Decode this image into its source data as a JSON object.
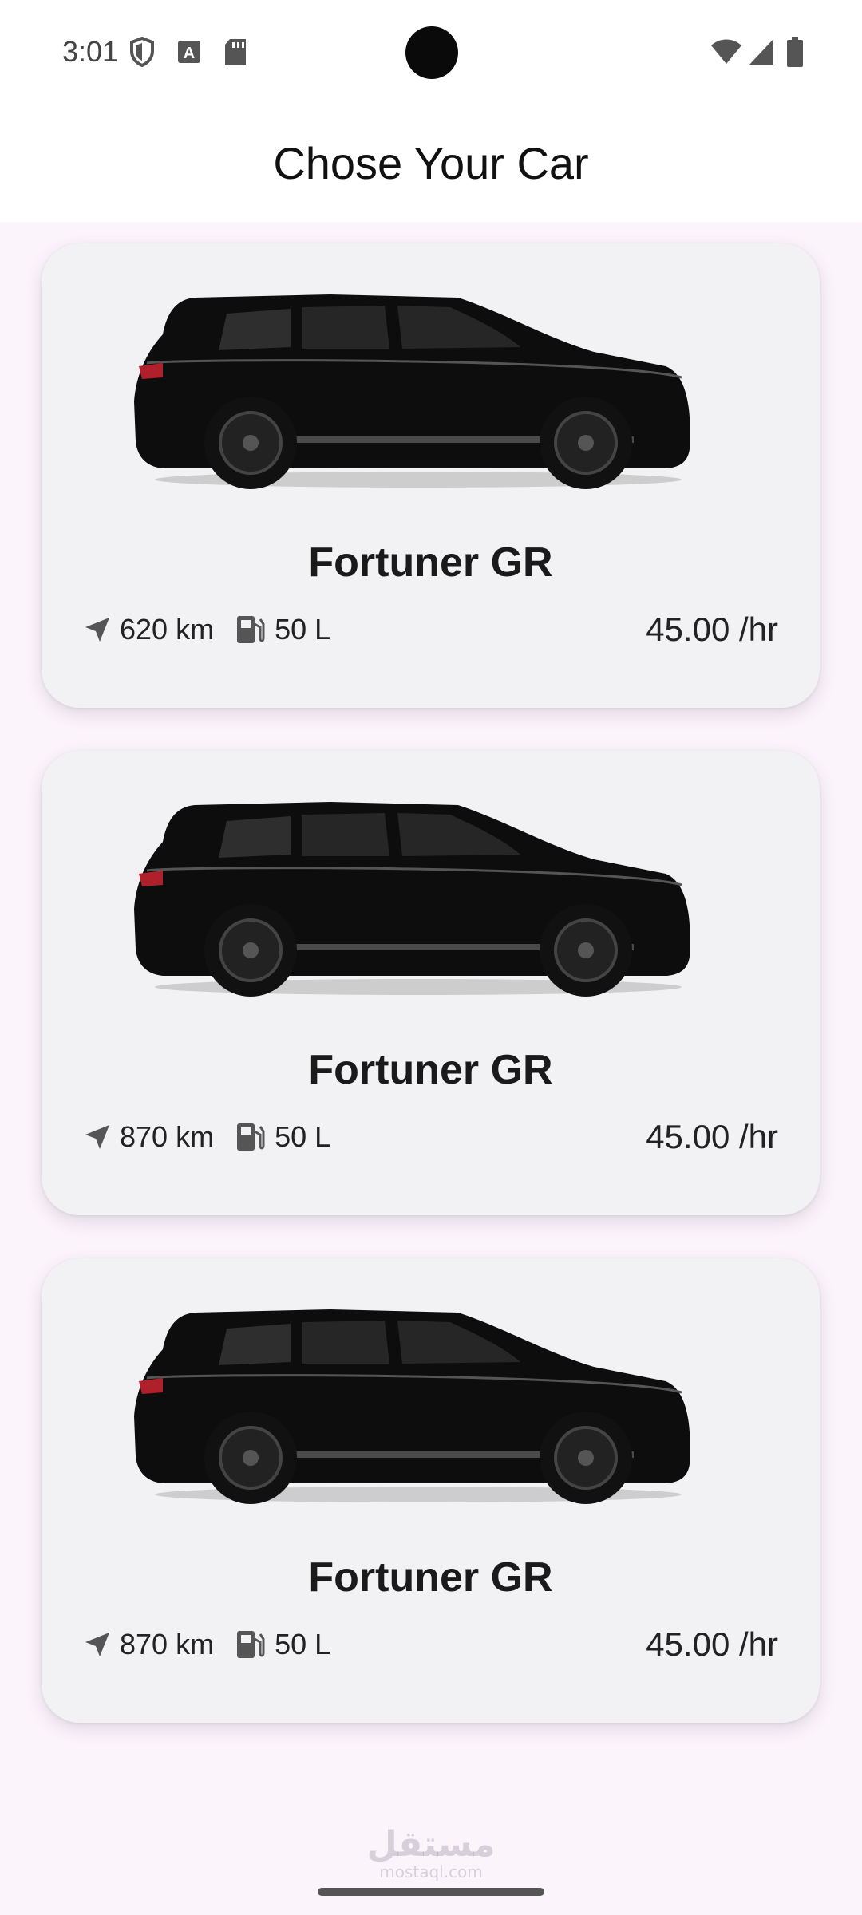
{
  "status_bar": {
    "time": "3:01",
    "left_icons": [
      "shield-icon",
      "keyboard-a-icon",
      "sd-card-icon"
    ],
    "right_icons": [
      "wifi-icon",
      "cellular-signal-icon",
      "battery-icon"
    ]
  },
  "app_bar": {
    "title": "Chose Your Car"
  },
  "cars": [
    {
      "name": "Fortuner GR",
      "distance": "620 km",
      "fuel": "50 L",
      "price": "45.00 /hr",
      "image_icon": "suv-car-image"
    },
    {
      "name": "Fortuner GR",
      "distance": "870 km",
      "fuel": "50 L",
      "price": "45.00 /hr",
      "image_icon": "suv-car-image"
    },
    {
      "name": "Fortuner GR",
      "distance": "870 km",
      "fuel": "50 L",
      "price": "45.00 /hr",
      "image_icon": "suv-car-image"
    }
  ],
  "watermark": {
    "arabic": "مستقل",
    "latin": "mostaql.com"
  },
  "colors": {
    "background": "#fcf4fb",
    "card": "#f2f1f3",
    "car_body": "#0d0d0d"
  }
}
